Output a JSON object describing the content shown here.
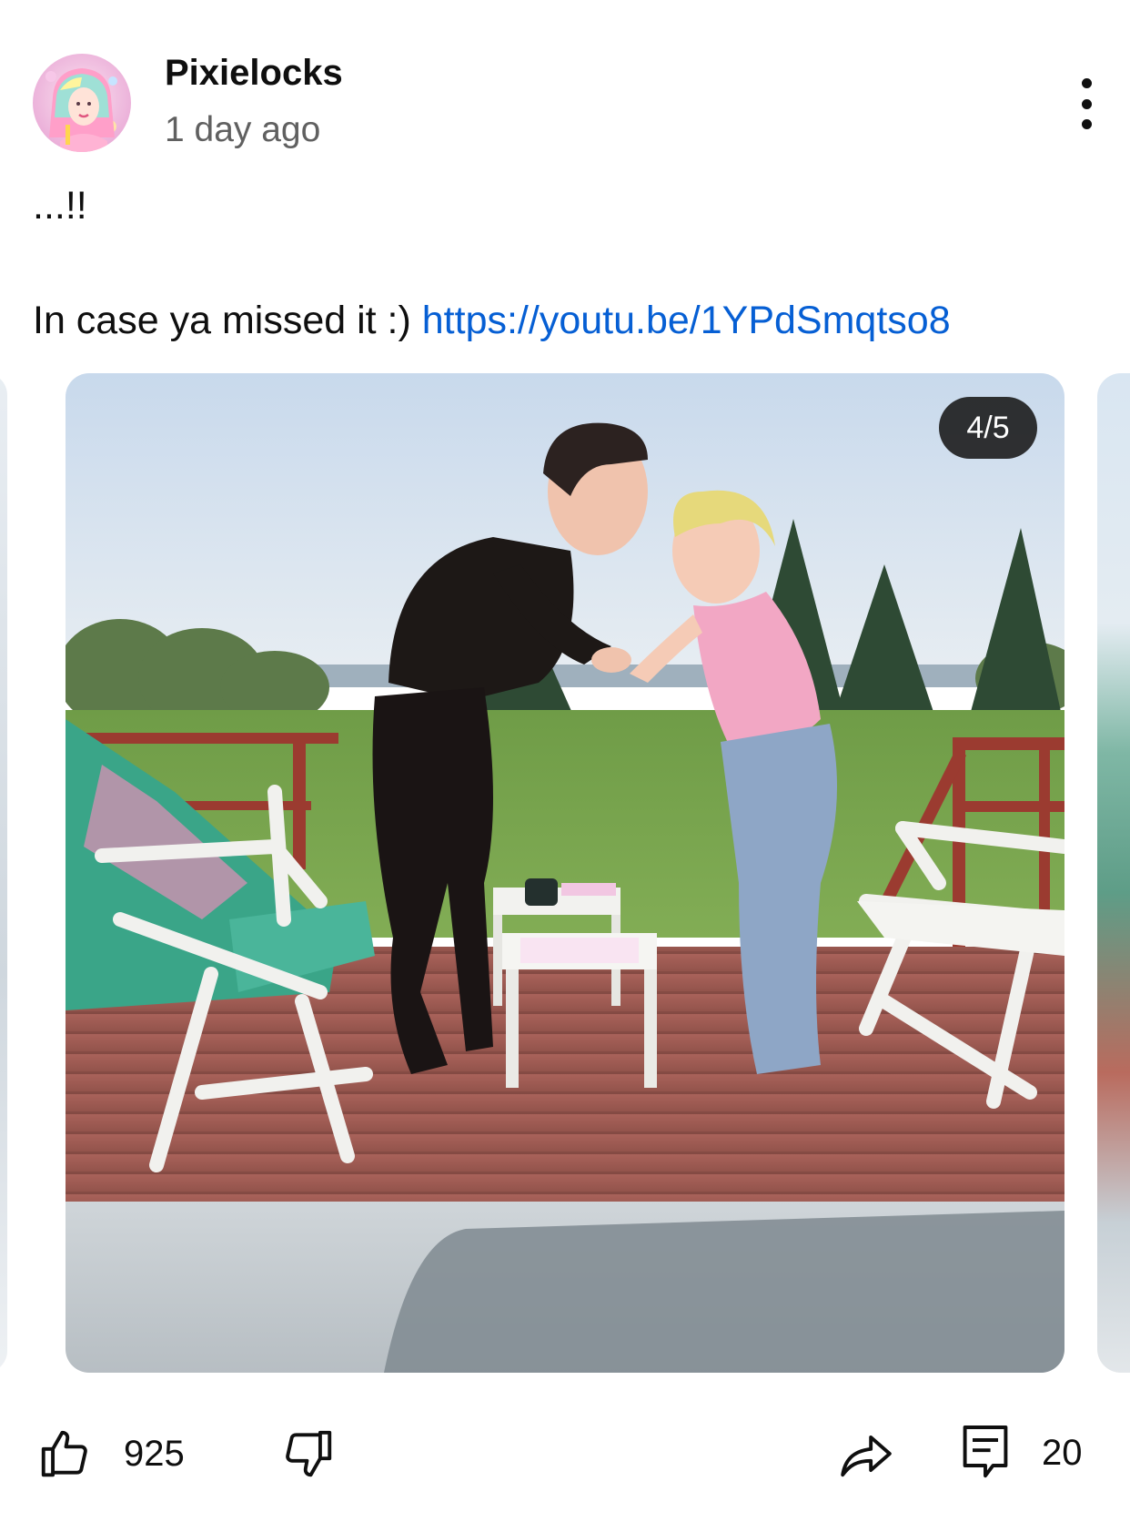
{
  "post": {
    "channel_name": "Pixielocks",
    "time_ago": "1 day ago",
    "text_line1": "...!!",
    "text_line2": "In case ya missed it :) ",
    "link_text": "https://youtu.be/1YPdSmqtso8"
  },
  "carousel": {
    "counter": "4/5"
  },
  "actions": {
    "like_count": "925",
    "comment_count": "20"
  },
  "icons": {
    "avatar": "avatar-image",
    "more": "more-vert-icon",
    "like": "thumbs-up-icon",
    "dislike": "thumbs-down-icon",
    "share": "share-arrow-icon",
    "comments": "comment-icon"
  },
  "colors": {
    "link": "#065fd4",
    "secondary_text": "#606060",
    "counter_bg": "#1c1c1c"
  }
}
